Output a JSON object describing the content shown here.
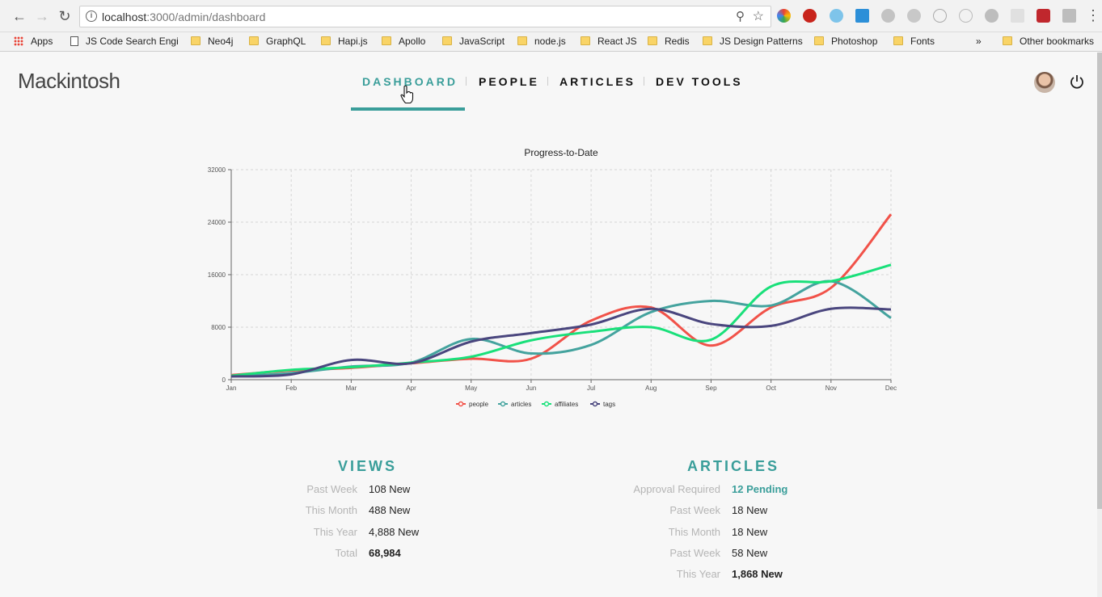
{
  "browser": {
    "url_host": "localhost",
    "url_path": ":3000/admin/dashboard",
    "bookmarks": [
      {
        "label": "Apps",
        "icon": "apps-icon"
      },
      {
        "label": "JS Code Search Engi",
        "icon": "page-icon"
      },
      {
        "label": "Neo4j",
        "icon": "folder-icon"
      },
      {
        "label": "GraphQL",
        "icon": "folder-icon"
      },
      {
        "label": "Hapi.js",
        "icon": "folder-icon"
      },
      {
        "label": "Apollo",
        "icon": "folder-icon"
      },
      {
        "label": "JavaScript",
        "icon": "folder-icon"
      },
      {
        "label": "node.js",
        "icon": "folder-icon"
      },
      {
        "label": "React JS",
        "icon": "folder-icon"
      },
      {
        "label": "Redis",
        "icon": "folder-icon"
      },
      {
        "label": "JS Design Patterns",
        "icon": "folder-icon"
      },
      {
        "label": "Photoshop",
        "icon": "folder-icon"
      },
      {
        "label": "Fonts",
        "icon": "folder-icon"
      }
    ],
    "overflow": "»",
    "other_bookmarks": "Other bookmarks"
  },
  "app": {
    "logo": "Mackintosh",
    "nav": [
      "DASHBOARD",
      "PEOPLE",
      "ARTICLES",
      "DEV TOOLS"
    ],
    "accent": "#3a9e9a"
  },
  "chart_data": {
    "type": "line",
    "title": "Progress-to-Date",
    "categories": [
      "Jan",
      "Feb",
      "Mar",
      "Apr",
      "May",
      "Jun",
      "Jul",
      "Aug",
      "Sep",
      "Oct",
      "Nov",
      "Dec"
    ],
    "ylim": [
      0,
      32000
    ],
    "yticks": [
      "0",
      "8000",
      "16000",
      "24000",
      "32000"
    ],
    "grid": true,
    "legend_position": "bottom",
    "series": [
      {
        "name": "people",
        "color": "#f15249",
        "values": [
          700,
          1400,
          1800,
          2500,
          3200,
          3200,
          9000,
          11000,
          5200,
          11000,
          14000,
          25200
        ]
      },
      {
        "name": "articles",
        "color": "#44a39e",
        "values": [
          500,
          1000,
          2000,
          2600,
          6200,
          4000,
          5300,
          10300,
          12000,
          11300,
          15000,
          9400
        ]
      },
      {
        "name": "affiliates",
        "color": "#19e07a",
        "values": [
          600,
          1500,
          1900,
          2600,
          3500,
          6000,
          7300,
          8000,
          6100,
          14200,
          15000,
          17500
        ]
      },
      {
        "name": "tags",
        "color": "#4a467e",
        "values": [
          500,
          800,
          3000,
          2500,
          5800,
          7100,
          8400,
          10800,
          8500,
          8200,
          10800,
          10700
        ]
      }
    ]
  },
  "views": {
    "title": "VIEWS",
    "rows": [
      {
        "label": "Past Week",
        "value": "108 New"
      },
      {
        "label": "This Month",
        "value": "488 New"
      },
      {
        "label": "This Year",
        "value": "4,888 New"
      },
      {
        "label": "Total",
        "value": "68,984"
      }
    ]
  },
  "articles": {
    "title": "ARTICLES",
    "rows": [
      {
        "label": "Approval Required",
        "value": "12 Pending"
      },
      {
        "label": "Past Week",
        "value": "18 New"
      },
      {
        "label": "This Month",
        "value": "18 New"
      },
      {
        "label": "Past Week",
        "value": "58 New"
      },
      {
        "label": "This Year",
        "value": "1,868 New"
      }
    ]
  }
}
